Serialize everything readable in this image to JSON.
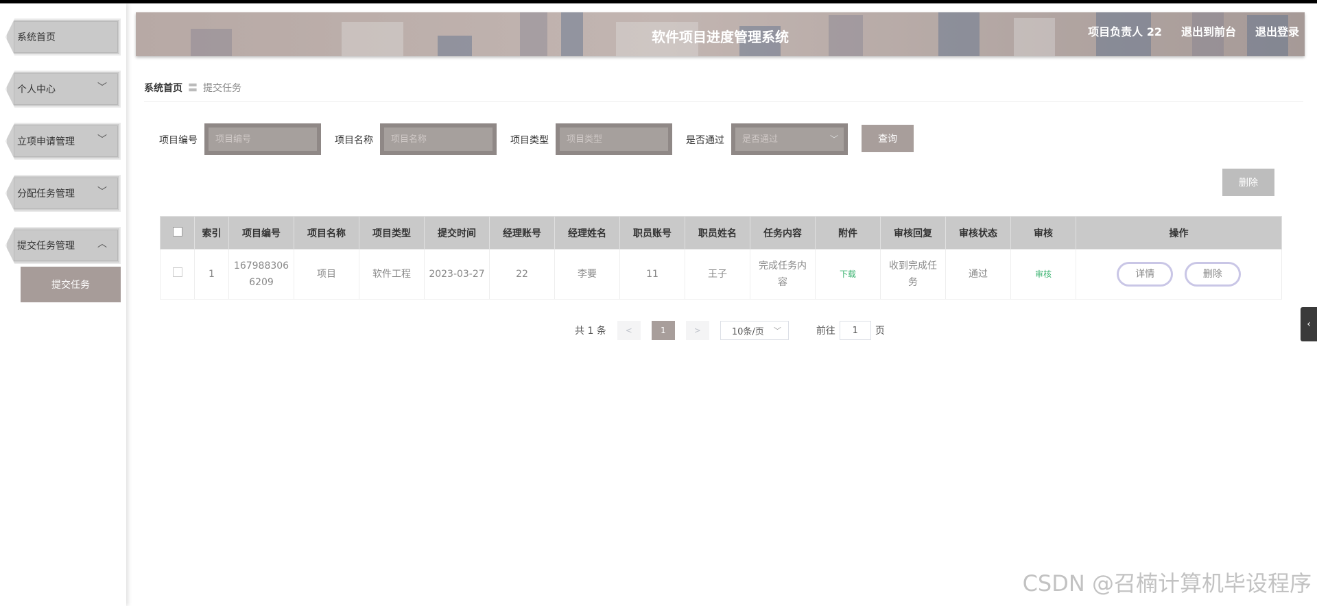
{
  "sidebar": {
    "items": [
      {
        "label": "系统首页",
        "chevron": ""
      },
      {
        "label": "个人中心",
        "chevron": "﹀"
      },
      {
        "label": "立项申请管理",
        "chevron": "﹀"
      },
      {
        "label": "分配任务管理",
        "chevron": "﹀"
      },
      {
        "label": "提交任务管理",
        "chevron": "︿"
      }
    ],
    "sub_item": "提交任务"
  },
  "header": {
    "title": "软件项目进度管理系统",
    "user": "项目负责人 22",
    "back_front": "退出到前台",
    "logout": "退出登录"
  },
  "breadcrumb": {
    "home": "系统首页",
    "separator": "〓",
    "current": "提交任务"
  },
  "search": {
    "fields": [
      {
        "label": "项目编号",
        "placeholder": "项目编号"
      },
      {
        "label": "项目名称",
        "placeholder": "项目名称"
      },
      {
        "label": "项目类型",
        "placeholder": "项目类型"
      },
      {
        "label": "是否通过",
        "placeholder": "是否通过"
      }
    ],
    "query_button": "查询",
    "delete_button": "删除"
  },
  "table": {
    "columns": [
      "索引",
      "项目编号",
      "项目名称",
      "项目类型",
      "提交时间",
      "经理账号",
      "经理姓名",
      "职员账号",
      "职员姓名",
      "任务内容",
      "附件",
      "审核回复",
      "审核状态",
      "审核",
      "操作"
    ],
    "rows": [
      {
        "index": "1",
        "project_no": "1679883066209",
        "project_name": "项目",
        "project_type": "软件工程",
        "submit_time": "2023-03-27",
        "manager_account": "22",
        "manager_name": "李要",
        "staff_account": "11",
        "staff_name": "王子",
        "task_content": "完成任务内容",
        "attachment": "下载",
        "review_reply": "收到完成任务",
        "review_status": "通过",
        "review": "审核",
        "detail_button": "详情",
        "delete_button": "删除"
      }
    ]
  },
  "pagination": {
    "total": "共 1 条",
    "prev": "<",
    "current_page": "1",
    "next": ">",
    "page_size": "10条/页",
    "goto_label": "前往",
    "goto_value": "1",
    "page_suffix": "页"
  },
  "side_toggle": "‹",
  "watermark": "CSDN @召楠计算机毕设程序"
}
